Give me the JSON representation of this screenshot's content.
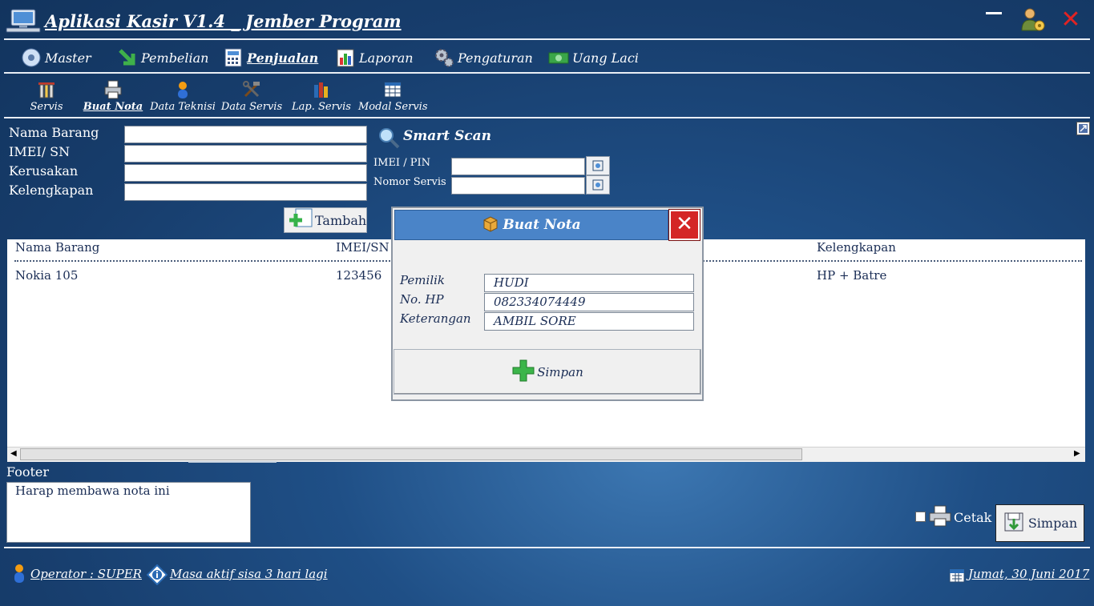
{
  "window": {
    "title": "Aplikasi Kasir V1.4 _ Jember Program"
  },
  "menu": {
    "items": [
      {
        "label": "Master",
        "icon": "disc-icon"
      },
      {
        "label": "Pembelian",
        "icon": "download-arrow-icon"
      },
      {
        "label": "Penjualan",
        "icon": "calculator-icon",
        "active": true
      },
      {
        "label": "Laporan",
        "icon": "report-chart-icon"
      },
      {
        "label": "Pengaturan",
        "icon": "gears-icon"
      },
      {
        "label": "Uang Laci",
        "icon": "money-icon"
      }
    ]
  },
  "submenu": {
    "items": [
      {
        "label": "Servis",
        "icon": "phone-repair-icon"
      },
      {
        "label": "Buat Nota",
        "icon": "printer-icon",
        "active": true
      },
      {
        "label": "Data Teknisi",
        "icon": "person-icon"
      },
      {
        "label": "Data Servis",
        "icon": "tools-icon"
      },
      {
        "label": "Lap. Servis",
        "icon": "books-icon"
      },
      {
        "label": "Modal Servis",
        "icon": "table-icon"
      }
    ]
  },
  "form": {
    "nama_barang_label": "Nama Barang",
    "imei_label": "IMEI/ SN",
    "kerusakan_label": "Kerusakan",
    "kelengkapan_label": "Kelengkapan",
    "nama_barang_value": "",
    "imei_value": "",
    "kerusakan_value": "",
    "kelengkapan_value": "",
    "tambah_label": "Tambah"
  },
  "smart_scan": {
    "title": "Smart Scan",
    "imei_pin_label": "IMEI / PIN",
    "nomor_servis_label": "Nomor Servis",
    "imei_pin_value": "",
    "nomor_servis_value": ""
  },
  "table": {
    "columns": [
      "Nama Barang",
      "IMEI/SN",
      "Kelengkapan"
    ],
    "rows": [
      {
        "nama_barang": "Nokia 105",
        "imei": "123456",
        "kelengkapan": "HP + Batre"
      }
    ]
  },
  "dialog": {
    "title": "Buat Nota",
    "pemilik_label": "Pemilik",
    "no_hp_label": "No. HP",
    "keterangan_label": "Keterangan",
    "pemilik_value": "HUDI",
    "no_hp_value": "082334074449",
    "keterangan_value": "AMBIL SORE",
    "simpan_label": "Simpan"
  },
  "footer": {
    "label": "Footer",
    "text": "Harap membawa nota ini",
    "cetak_label": "Cetak",
    "cetak_checked": false,
    "simpan_label": "Simpan"
  },
  "status": {
    "operator": "Operator : SUPER",
    "masa_aktif": "Masa aktif sisa 3 hari lagi",
    "date": "Jumat, 30 Juni 2017"
  },
  "colors": {
    "background": "#1f4f86",
    "dialog_header": "#4a84c8",
    "close_red": "#d42626",
    "text_dark": "#1a2d55"
  }
}
